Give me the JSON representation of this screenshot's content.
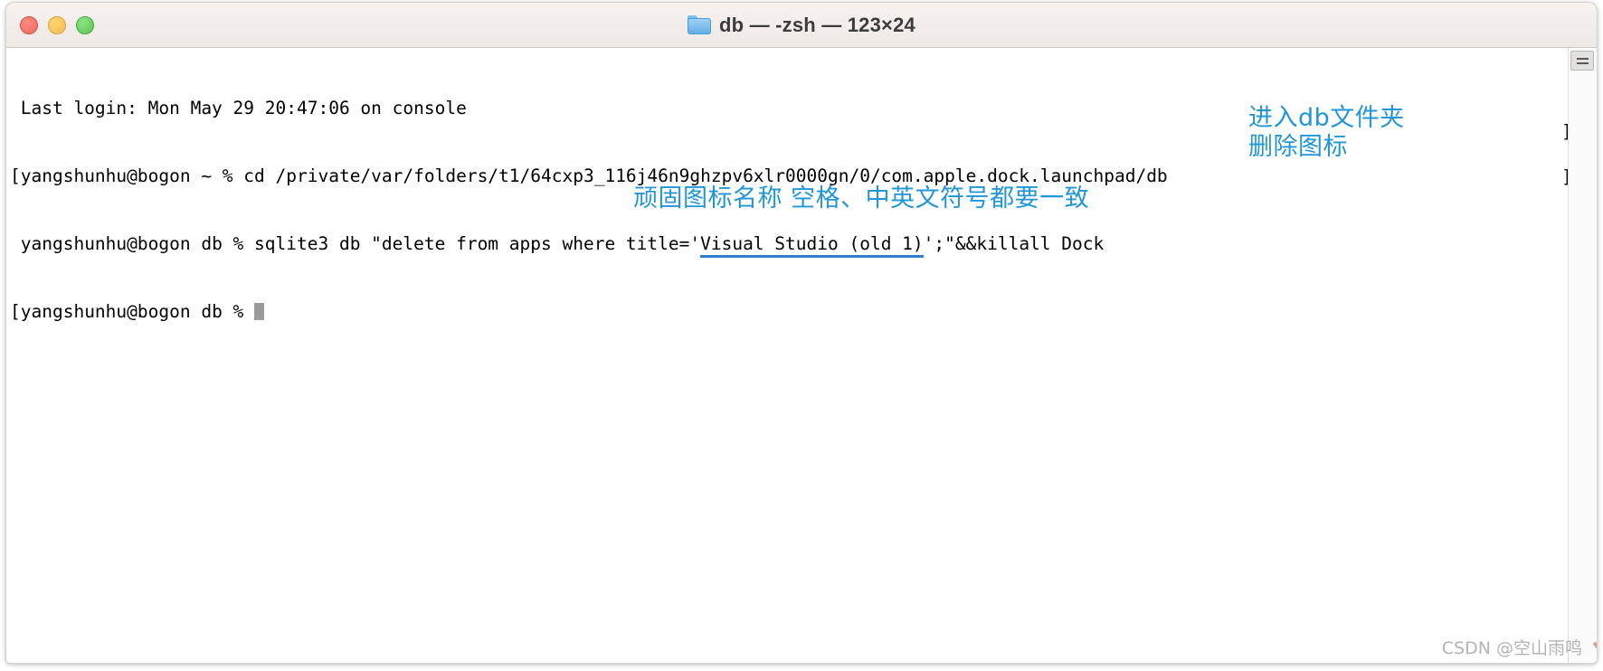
{
  "window": {
    "title": "db — -zsh — 123×24",
    "folder_icon": "folder-icon",
    "traffic_lights": {
      "close_label": "close",
      "minimize_label": "minimize",
      "zoom_label": "zoom"
    }
  },
  "terminal": {
    "lines": [
      {
        "id": "line-1",
        "bracket": "",
        "text": " Last login: Mon May 29 20:47:06 on console"
      },
      {
        "id": "line-2",
        "bracket": "[",
        "text": "yangshunhu@bogon ~ % cd /private/var/folders/t1/64cxp3_116j46n9ghzpv6xlr0000gn/0/com.apple.dock.launchpad/db"
      },
      {
        "id": "line-3",
        "bracket": " ",
        "pre": "yangshunhu@bogon db % sqlite3 db \"delete from apps where title='",
        "underlined": "Visual Studio (old 1)",
        "post": "';\"&&killall Dock"
      },
      {
        "id": "line-4",
        "bracket": "[",
        "text": "yangshunhu@bogon db % "
      }
    ],
    "wrap_brackets": [
      "]",
      "]"
    ]
  },
  "annotations": {
    "right": [
      "进入db文件夹",
      "删除图标"
    ],
    "bottom": "顽固图标名称 空格、中英文符号都要一致",
    "color": "#2196d8",
    "underline_color": "#2f7fd0"
  },
  "watermark": {
    "text": "CSDN @空山雨鸣"
  },
  "scrollbar": {
    "marker_label": "scroll-marker"
  }
}
